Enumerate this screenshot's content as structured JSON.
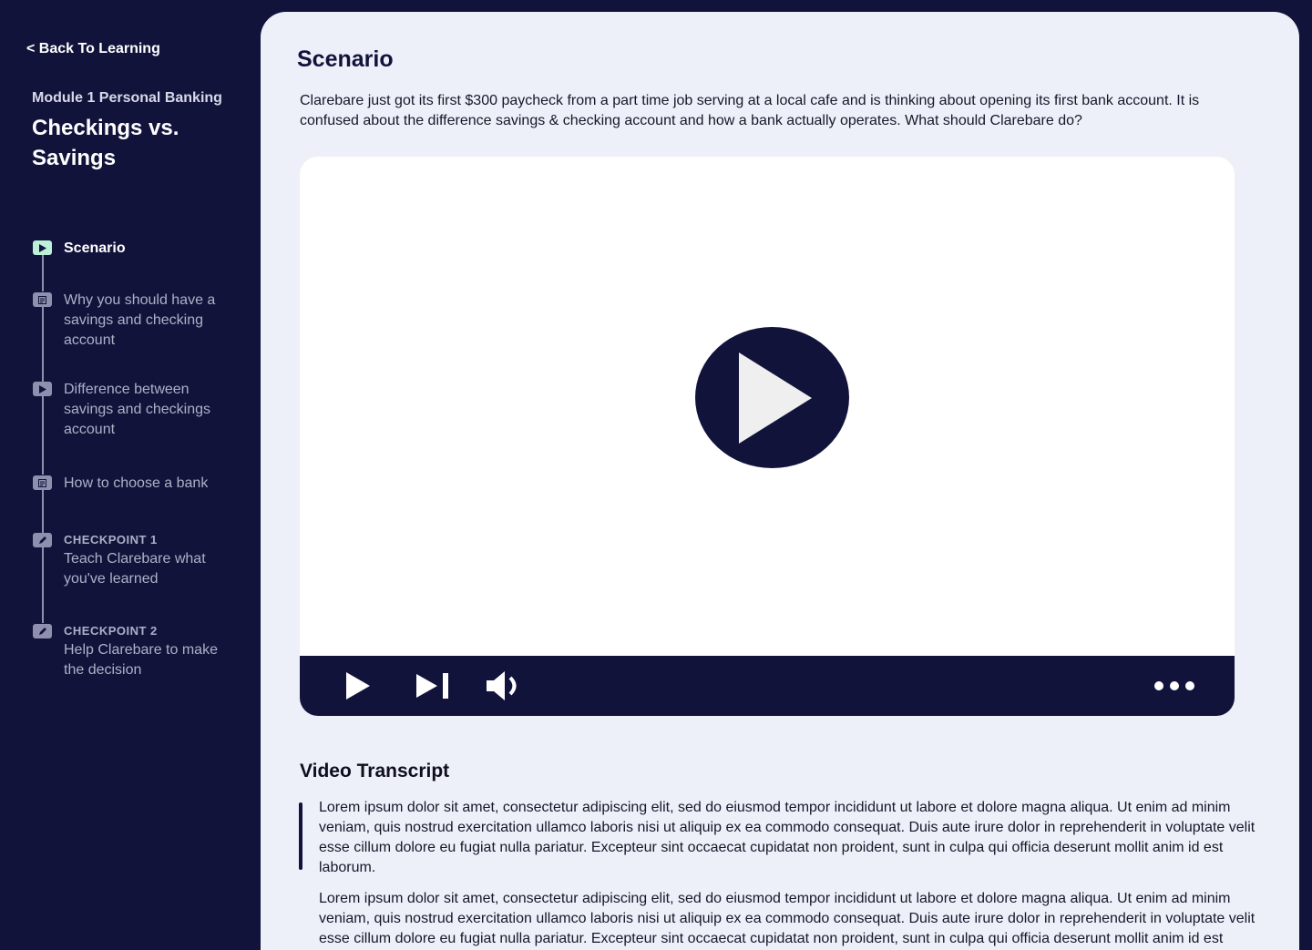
{
  "sidebar": {
    "back_label": "< Back To Learning",
    "module_label": "Module 1 Personal Banking",
    "module_title": "Checkings vs. Savings",
    "steps": [
      {
        "kicker": "",
        "label": "Scenario",
        "icon": "play-icon",
        "active": true
      },
      {
        "kicker": "",
        "label": "Why you should have a savings and checking account",
        "icon": "document-icon",
        "active": false
      },
      {
        "kicker": "",
        "label": "Difference between savings and checkings account",
        "icon": "play-icon",
        "active": false
      },
      {
        "kicker": "",
        "label": "How to choose a bank",
        "icon": "document-icon",
        "active": false
      },
      {
        "kicker": "CHECKPOINT 1",
        "label": "Teach Clarebare what you've learned",
        "icon": "pencil-icon",
        "active": false
      },
      {
        "kicker": "CHECKPOINT 2",
        "label": "Help Clarebare to make the decision",
        "icon": "pencil-icon",
        "active": false
      }
    ]
  },
  "main": {
    "title": "Scenario",
    "scenario_text": "Clarebare just got its first $300 paycheck from a part time job serving at a local cafe and is thinking about opening its first bank account. It is confused about the difference savings &  checking account and how a bank actually operates. What should Clarebare do?",
    "video": {
      "controls": [
        "play-icon",
        "skip-next-icon",
        "volume-icon",
        "more-icon"
      ]
    },
    "transcript": {
      "title": "Video Transcript",
      "paragraphs": [
        "Lorem ipsum dolor sit amet, consectetur adipiscing elit, sed do eiusmod tempor incididunt ut labore et dolore magna aliqua. Ut enim ad minim veniam, quis nostrud exercitation ullamco laboris nisi ut aliquip ex ea commodo consequat. Duis aute irure dolor in reprehenderit in voluptate velit esse cillum dolore eu fugiat nulla pariatur. Excepteur sint occaecat cupidatat non proident, sunt in culpa qui officia deserunt mollit anim id est laborum.",
        "Lorem ipsum dolor sit amet, consectetur adipiscing elit, sed do eiusmod tempor incididunt ut labore et dolore magna aliqua. Ut enim ad minim veniam, quis nostrud exercitation ullamco laboris nisi ut aliquip ex ea commodo consequat. Duis aute irure dolor in reprehenderit in voluptate velit esse cillum dolore eu fugiat nulla pariatur. Excepteur sint occaecat cupidatat non proident, sunt in culpa qui officia deserunt mollit anim id est laborum."
      ]
    }
  },
  "colors": {
    "navy": "#12133b",
    "panel": "#eef0f9",
    "active_icon": "#bdf0d8",
    "inactive": "#8e90ad"
  }
}
